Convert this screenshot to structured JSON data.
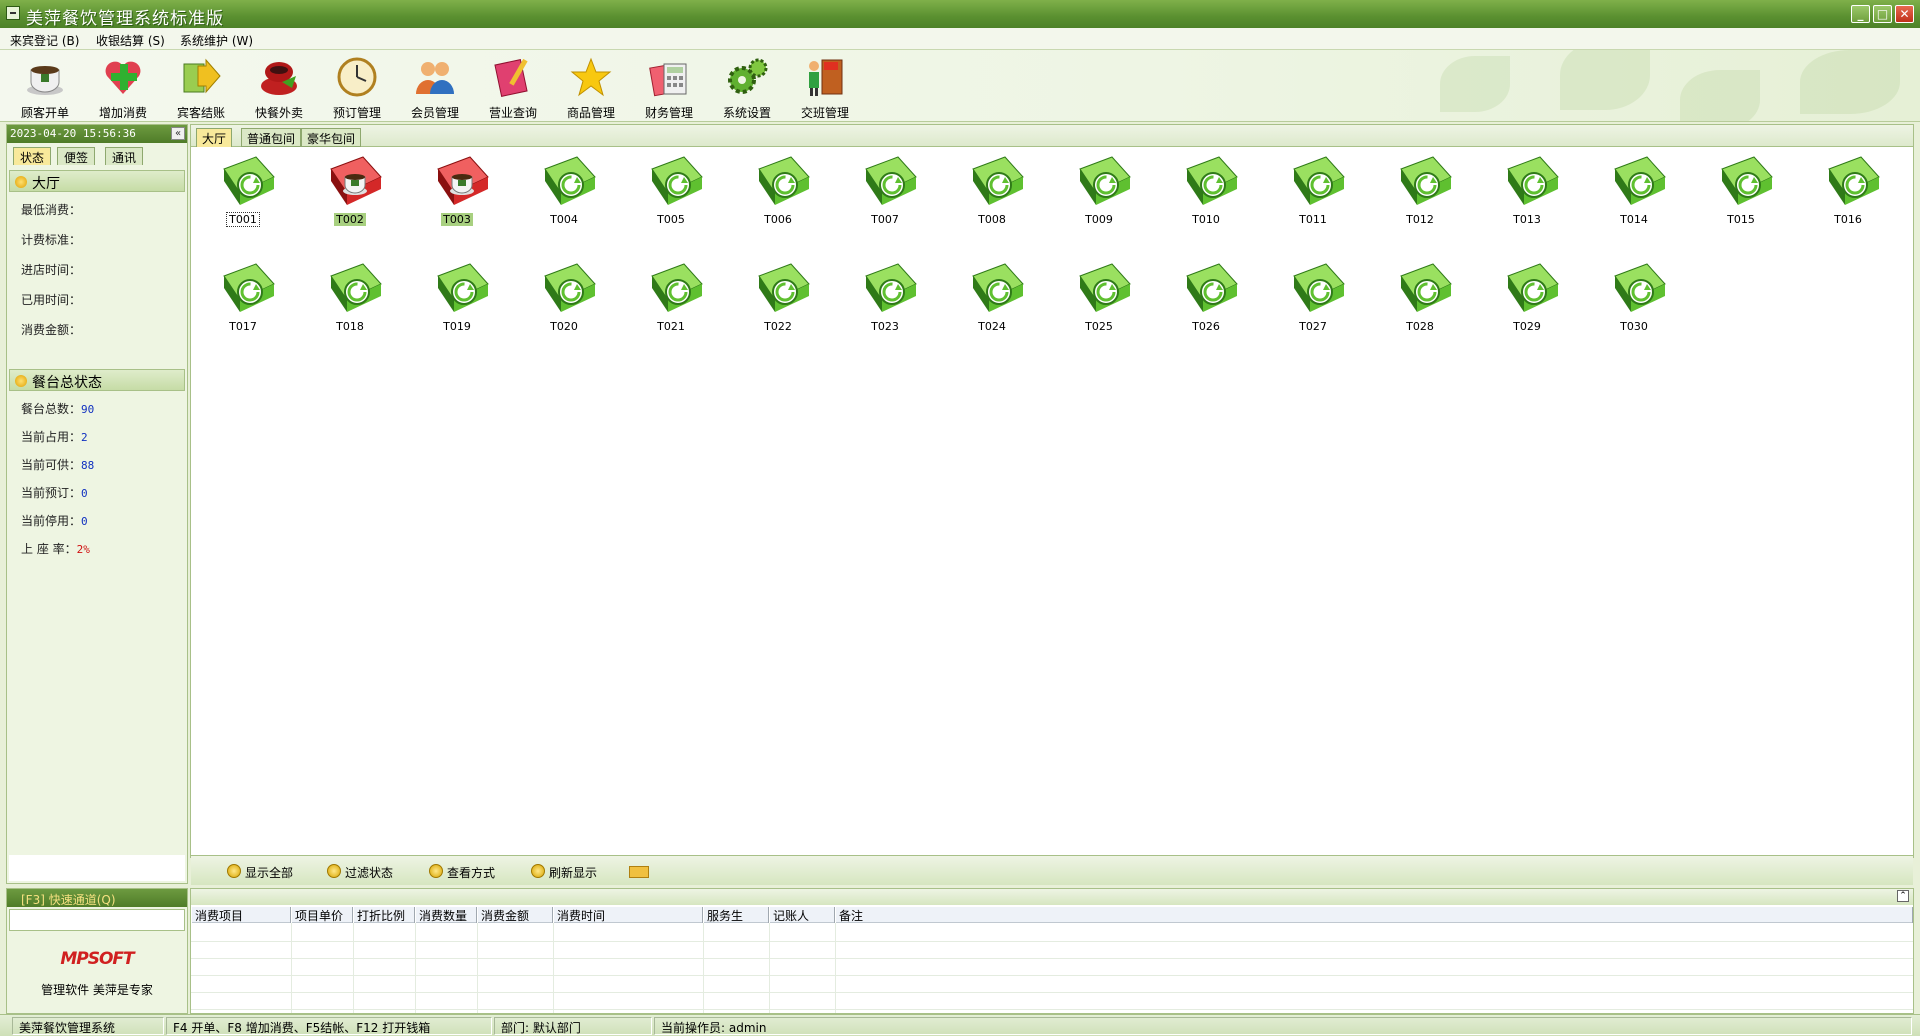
{
  "window": {
    "title": "美萍餐饮管理系统标准版",
    "controls": [
      "_",
      "□",
      "✕"
    ]
  },
  "menu": [
    {
      "label": "来宾登记 (B)"
    },
    {
      "label": "收银结算 (S)"
    },
    {
      "label": "系统维护 (W)"
    }
  ],
  "toolbar": [
    {
      "label": "顾客开单",
      "icon": "teacup-icon"
    },
    {
      "label": "增加消费",
      "icon": "plus-heart-icon"
    },
    {
      "label": "宾客结账",
      "icon": "money-arrow-icon"
    },
    {
      "label": "快餐外卖",
      "icon": "takeout-icon"
    },
    {
      "label": "预订管理",
      "icon": "clock-icon"
    },
    {
      "label": "会员管理",
      "icon": "users-icon"
    },
    {
      "label": "营业查询",
      "icon": "book-pencil-icon"
    },
    {
      "label": "商品管理",
      "icon": "star-icon"
    },
    {
      "label": "财务管理",
      "icon": "calculator-icon"
    },
    {
      "label": "系统设置",
      "icon": "gears-icon"
    },
    {
      "label": "交班管理",
      "icon": "exit-door-icon"
    }
  ],
  "left": {
    "datetime": "2023-04-20 15:56:36",
    "collapse": "«",
    "tabs": [
      {
        "label": "状态",
        "active": true
      },
      {
        "label": "便签",
        "active": false
      },
      {
        "label": "通讯",
        "active": false
      }
    ],
    "hall_section": {
      "title": "大厅",
      "fields": [
        {
          "label": "最低消费：",
          "value": ""
        },
        {
          "label": "计费标准：",
          "value": ""
        },
        {
          "label": "进店时间：",
          "value": ""
        },
        {
          "label": "已用时间：",
          "value": ""
        },
        {
          "label": "消费金额：",
          "value": ""
        }
      ]
    },
    "status_section": {
      "title": "餐台总状态",
      "fields": [
        {
          "label": "餐台总数：",
          "value": "90"
        },
        {
          "label": "当前占用：",
          "value": "2"
        },
        {
          "label": "当前可供：",
          "value": "88"
        },
        {
          "label": "当前预订：",
          "value": "0"
        },
        {
          "label": "当前停用：",
          "value": "0"
        },
        {
          "label": "上 座 率：",
          "value": "2%"
        }
      ]
    }
  },
  "main": {
    "tabs": [
      {
        "label": "大厅",
        "active": true
      },
      {
        "label": "普通包间",
        "active": false
      },
      {
        "label": "豪华包间",
        "active": false
      }
    ],
    "tables": [
      {
        "id": "T001",
        "status": "available",
        "selected": true
      },
      {
        "id": "T002",
        "status": "occupied"
      },
      {
        "id": "T003",
        "status": "occupied"
      },
      {
        "id": "T004",
        "status": "available"
      },
      {
        "id": "T005",
        "status": "available"
      },
      {
        "id": "T006",
        "status": "available"
      },
      {
        "id": "T007",
        "status": "available"
      },
      {
        "id": "T008",
        "status": "available"
      },
      {
        "id": "T009",
        "status": "available"
      },
      {
        "id": "T010",
        "status": "available"
      },
      {
        "id": "T011",
        "status": "available"
      },
      {
        "id": "T012",
        "status": "available"
      },
      {
        "id": "T013",
        "status": "available"
      },
      {
        "id": "T014",
        "status": "available"
      },
      {
        "id": "T015",
        "status": "available"
      },
      {
        "id": "T016",
        "status": "available"
      },
      {
        "id": "T017",
        "status": "available"
      },
      {
        "id": "T018",
        "status": "available"
      },
      {
        "id": "T019",
        "status": "available"
      },
      {
        "id": "T020",
        "status": "available"
      },
      {
        "id": "T021",
        "status": "available"
      },
      {
        "id": "T022",
        "status": "available"
      },
      {
        "id": "T023",
        "status": "available"
      },
      {
        "id": "T024",
        "status": "available"
      },
      {
        "id": "T025",
        "status": "available"
      },
      {
        "id": "T026",
        "status": "available"
      },
      {
        "id": "T027",
        "status": "available"
      },
      {
        "id": "T028",
        "status": "available"
      },
      {
        "id": "T029",
        "status": "available"
      },
      {
        "id": "T030",
        "status": "available"
      }
    ],
    "footer": [
      {
        "label": "显示全部"
      },
      {
        "label": "过滤状态"
      },
      {
        "label": "查看方式"
      },
      {
        "label": "刷新显示"
      }
    ]
  },
  "quick": {
    "title": "[F3] 快速通道(Q)",
    "input_value": "",
    "brand": "MPSOFT",
    "slogan": "管理软件 美萍是专家"
  },
  "detail": {
    "expand": "⌃",
    "columns": [
      "消费项目",
      "项目单价",
      "打折比例",
      "消费数量",
      "消费金额",
      "消费时间",
      "服务生",
      "记账人",
      "备注"
    ],
    "rows": []
  },
  "statusbar": [
    {
      "text": "美萍餐饮管理系统"
    },
    {
      "text": "F4 开单、F8 增加消费、F5结帐、F12 打开钱箱"
    },
    {
      "text": "部门: 默认部门"
    },
    {
      "text": "当前操作员: admin"
    }
  ],
  "colors": {
    "available": "#5fc030",
    "occupied": "#d42828",
    "accent": "#5a9030"
  }
}
